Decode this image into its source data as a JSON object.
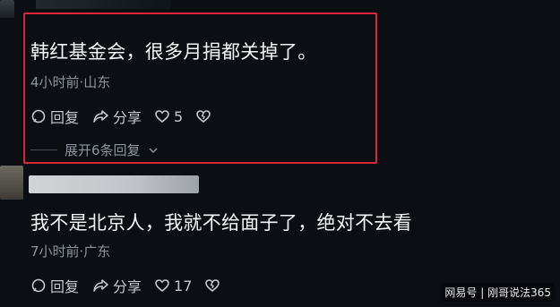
{
  "comments": [
    {
      "text": "韩红基金会，很多月捐都关掉了。",
      "meta": "4小时前·山东",
      "reply_label": "回复",
      "share_label": "分享",
      "like_count": "5",
      "expand_label": "展开6条回复"
    },
    {
      "text": "我不是北京人，我就不给面子了，绝对不去看",
      "meta": "7小时前·广东",
      "reply_label": "回复",
      "share_label": "分享",
      "like_count": "17"
    }
  ],
  "watermark": "网易号 | 刚哥说法365",
  "colors": {
    "background": "#0b0f14",
    "highlight": "#d9263b",
    "text": "#f5f6f7",
    "meta": "#8e949c"
  }
}
